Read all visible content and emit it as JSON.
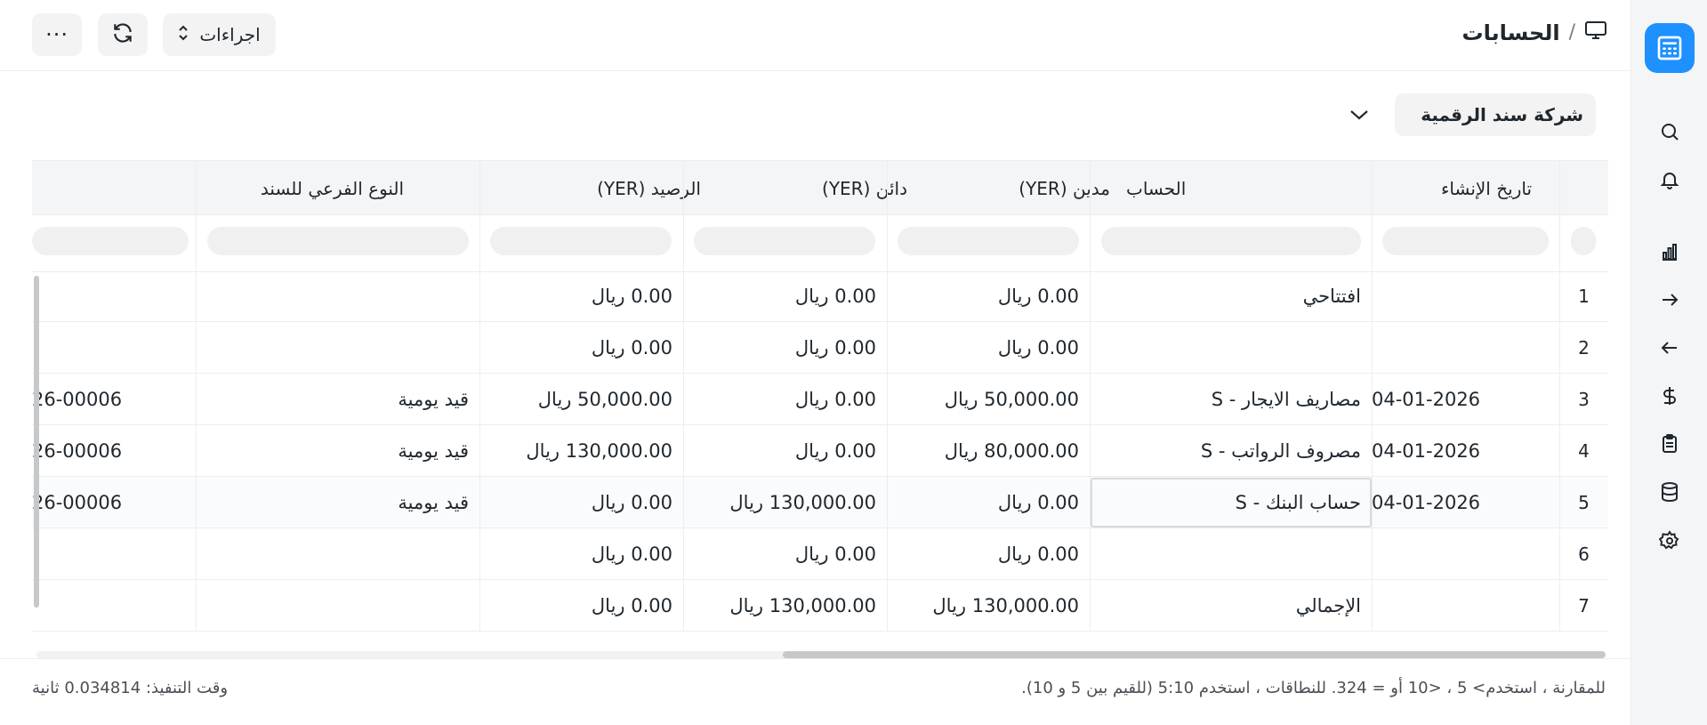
{
  "app": {
    "breadcrumb": {
      "separator": "/",
      "title": "الحسابات"
    },
    "actions_label": "اجراءات",
    "more_label": "···"
  },
  "sidebar": {
    "items": [
      {
        "name": "search-icon"
      },
      {
        "name": "bell-icon"
      },
      {
        "name": "bar-chart-icon"
      },
      {
        "name": "arrow-right-icon"
      },
      {
        "name": "arrow-left-icon"
      },
      {
        "name": "dollar-icon"
      },
      {
        "name": "clipboard-icon"
      },
      {
        "name": "database-icon"
      },
      {
        "name": "gear-icon"
      }
    ]
  },
  "filters": {
    "company": "شركة سند الرقمية"
  },
  "table": {
    "columns": {
      "created": "تاريخ الإنشاء",
      "account": "الحساب",
      "debit": "مدين (YER)",
      "credit": "دائن (YER)",
      "balance": "الرصيد (YER)",
      "subtype": "النوع الفرعي للسند"
    },
    "rows": [
      {
        "idx": "1",
        "created": "",
        "account": "افتتاحي",
        "debit": "0.00 ريال",
        "credit": "0.00 ريال",
        "balance": "0.00 ريال",
        "subtype": "",
        "voucher": ""
      },
      {
        "idx": "2",
        "created": "",
        "account": "",
        "debit": "0.00 ريال",
        "credit": "0.00 ريال",
        "balance": "0.00 ريال",
        "subtype": "",
        "voucher": ""
      },
      {
        "idx": "3",
        "created": "04-01-2026",
        "account": "مصاريف الايجار - S",
        "debit": "50,000.00 ريال",
        "credit": "0.00 ريال",
        "balance": "50,000.00 ريال",
        "subtype": "قيد يومية",
        "voucher": "26-00006"
      },
      {
        "idx": "4",
        "created": "04-01-2026",
        "account": "مصروف الرواتب - S",
        "debit": "80,000.00 ريال",
        "credit": "0.00 ريال",
        "balance": "130,000.00 ريال",
        "subtype": "قيد يومية",
        "voucher": "26-00006"
      },
      {
        "idx": "5",
        "created": "04-01-2026",
        "account": "حساب البنك - S",
        "debit": "0.00 ريال",
        "credit": "130,000.00 ريال",
        "balance": "0.00 ريال",
        "subtype": "قيد يومية",
        "voucher": "26-00006"
      },
      {
        "idx": "6",
        "created": "",
        "account": "",
        "debit": "0.00 ريال",
        "credit": "0.00 ريال",
        "balance": "0.00 ريال",
        "subtype": "",
        "voucher": ""
      },
      {
        "idx": "7",
        "created": "",
        "account": "الإجمالي",
        "debit": "130,000.00 ريال",
        "credit": "130,000.00 ريال",
        "balance": "0.00 ريال",
        "subtype": "",
        "voucher": ""
      }
    ]
  },
  "footer": {
    "hint": "للمقارنة ، استخدم> 5 ، <10 أو = 324. للنطاقات ، استخدم 5:10 (للقيم بين 5 و 10).",
    "exec_time": "وقت التنفيذ: 0.034814 ثانية"
  },
  "colors": {
    "accent": "#1e90ff",
    "border": "#ebeef0",
    "header_bg": "#f4f5f6"
  }
}
